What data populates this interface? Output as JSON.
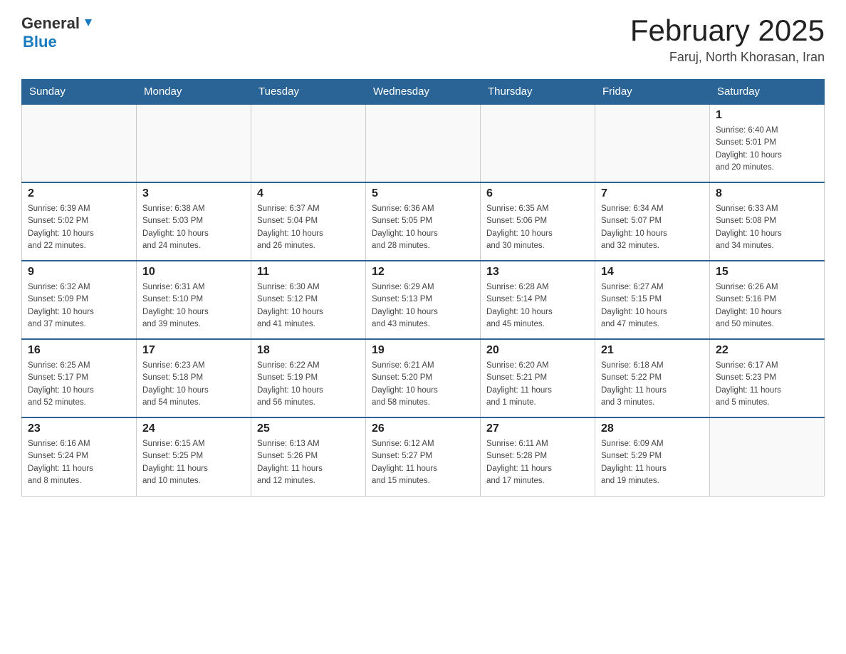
{
  "header": {
    "logo": {
      "general": "General",
      "arrow": "▲",
      "blue": "Blue"
    },
    "title": "February 2025",
    "location": "Faruj, North Khorasan, Iran"
  },
  "weekdays": [
    "Sunday",
    "Monday",
    "Tuesday",
    "Wednesday",
    "Thursday",
    "Friday",
    "Saturday"
  ],
  "weeks": [
    {
      "days": [
        {
          "num": "",
          "info": ""
        },
        {
          "num": "",
          "info": ""
        },
        {
          "num": "",
          "info": ""
        },
        {
          "num": "",
          "info": ""
        },
        {
          "num": "",
          "info": ""
        },
        {
          "num": "",
          "info": ""
        },
        {
          "num": "1",
          "info": "Sunrise: 6:40 AM\nSunset: 5:01 PM\nDaylight: 10 hours\nand 20 minutes."
        }
      ]
    },
    {
      "days": [
        {
          "num": "2",
          "info": "Sunrise: 6:39 AM\nSunset: 5:02 PM\nDaylight: 10 hours\nand 22 minutes."
        },
        {
          "num": "3",
          "info": "Sunrise: 6:38 AM\nSunset: 5:03 PM\nDaylight: 10 hours\nand 24 minutes."
        },
        {
          "num": "4",
          "info": "Sunrise: 6:37 AM\nSunset: 5:04 PM\nDaylight: 10 hours\nand 26 minutes."
        },
        {
          "num": "5",
          "info": "Sunrise: 6:36 AM\nSunset: 5:05 PM\nDaylight: 10 hours\nand 28 minutes."
        },
        {
          "num": "6",
          "info": "Sunrise: 6:35 AM\nSunset: 5:06 PM\nDaylight: 10 hours\nand 30 minutes."
        },
        {
          "num": "7",
          "info": "Sunrise: 6:34 AM\nSunset: 5:07 PM\nDaylight: 10 hours\nand 32 minutes."
        },
        {
          "num": "8",
          "info": "Sunrise: 6:33 AM\nSunset: 5:08 PM\nDaylight: 10 hours\nand 34 minutes."
        }
      ]
    },
    {
      "days": [
        {
          "num": "9",
          "info": "Sunrise: 6:32 AM\nSunset: 5:09 PM\nDaylight: 10 hours\nand 37 minutes."
        },
        {
          "num": "10",
          "info": "Sunrise: 6:31 AM\nSunset: 5:10 PM\nDaylight: 10 hours\nand 39 minutes."
        },
        {
          "num": "11",
          "info": "Sunrise: 6:30 AM\nSunset: 5:12 PM\nDaylight: 10 hours\nand 41 minutes."
        },
        {
          "num": "12",
          "info": "Sunrise: 6:29 AM\nSunset: 5:13 PM\nDaylight: 10 hours\nand 43 minutes."
        },
        {
          "num": "13",
          "info": "Sunrise: 6:28 AM\nSunset: 5:14 PM\nDaylight: 10 hours\nand 45 minutes."
        },
        {
          "num": "14",
          "info": "Sunrise: 6:27 AM\nSunset: 5:15 PM\nDaylight: 10 hours\nand 47 minutes."
        },
        {
          "num": "15",
          "info": "Sunrise: 6:26 AM\nSunset: 5:16 PM\nDaylight: 10 hours\nand 50 minutes."
        }
      ]
    },
    {
      "days": [
        {
          "num": "16",
          "info": "Sunrise: 6:25 AM\nSunset: 5:17 PM\nDaylight: 10 hours\nand 52 minutes."
        },
        {
          "num": "17",
          "info": "Sunrise: 6:23 AM\nSunset: 5:18 PM\nDaylight: 10 hours\nand 54 minutes."
        },
        {
          "num": "18",
          "info": "Sunrise: 6:22 AM\nSunset: 5:19 PM\nDaylight: 10 hours\nand 56 minutes."
        },
        {
          "num": "19",
          "info": "Sunrise: 6:21 AM\nSunset: 5:20 PM\nDaylight: 10 hours\nand 58 minutes."
        },
        {
          "num": "20",
          "info": "Sunrise: 6:20 AM\nSunset: 5:21 PM\nDaylight: 11 hours\nand 1 minute."
        },
        {
          "num": "21",
          "info": "Sunrise: 6:18 AM\nSunset: 5:22 PM\nDaylight: 11 hours\nand 3 minutes."
        },
        {
          "num": "22",
          "info": "Sunrise: 6:17 AM\nSunset: 5:23 PM\nDaylight: 11 hours\nand 5 minutes."
        }
      ]
    },
    {
      "days": [
        {
          "num": "23",
          "info": "Sunrise: 6:16 AM\nSunset: 5:24 PM\nDaylight: 11 hours\nand 8 minutes."
        },
        {
          "num": "24",
          "info": "Sunrise: 6:15 AM\nSunset: 5:25 PM\nDaylight: 11 hours\nand 10 minutes."
        },
        {
          "num": "25",
          "info": "Sunrise: 6:13 AM\nSunset: 5:26 PM\nDaylight: 11 hours\nand 12 minutes."
        },
        {
          "num": "26",
          "info": "Sunrise: 6:12 AM\nSunset: 5:27 PM\nDaylight: 11 hours\nand 15 minutes."
        },
        {
          "num": "27",
          "info": "Sunrise: 6:11 AM\nSunset: 5:28 PM\nDaylight: 11 hours\nand 17 minutes."
        },
        {
          "num": "28",
          "info": "Sunrise: 6:09 AM\nSunset: 5:29 PM\nDaylight: 11 hours\nand 19 minutes."
        },
        {
          "num": "",
          "info": ""
        }
      ]
    }
  ]
}
